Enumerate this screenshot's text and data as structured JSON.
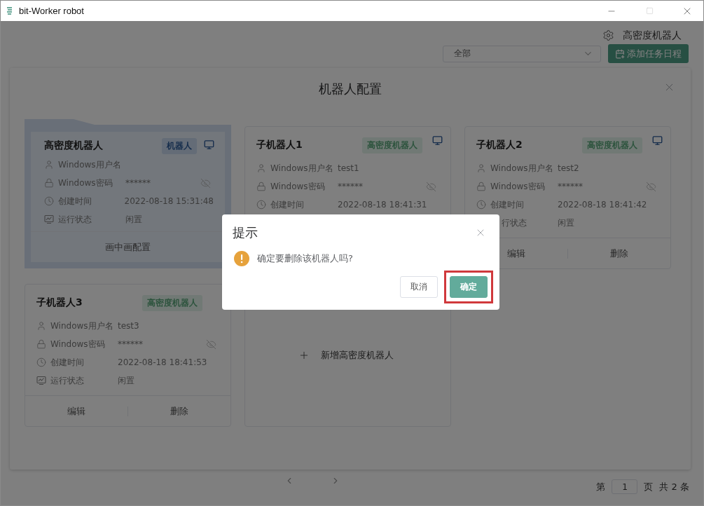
{
  "window": {
    "title": "bit-Worker robot"
  },
  "header": {
    "user": "高密度机器人",
    "filter": {
      "value": "全部"
    },
    "add_button": "添加任务日程"
  },
  "robot_config": {
    "title": "机器人配置",
    "cards": [
      {
        "kind": "robot",
        "selected": true,
        "name": "高密度机器人",
        "badge": "机器人",
        "monitor": true,
        "fields": [
          {
            "kind": "user",
            "label": "Windows用户名"
          },
          {
            "kind": "password",
            "label": "Windows密码",
            "value": "******"
          },
          {
            "kind": "time",
            "label": "创建时间",
            "value": "2022-08-18 15:31:48"
          },
          {
            "kind": "status",
            "label": "运行状态",
            "value": "闲置"
          }
        ],
        "actions": [
          "画中画配置"
        ]
      },
      {
        "kind": "robot",
        "selected": false,
        "name": "子机器人1",
        "badge": "高密度机器人",
        "monitor": true,
        "fields": [
          {
            "kind": "user",
            "label": "Windows用户名",
            "value": "test1"
          },
          {
            "kind": "password",
            "label": "Windows密码",
            "value": "******"
          },
          {
            "kind": "time",
            "label": "创建时间",
            "value": "2022-08-18 18:41:31"
          }
        ]
      },
      {
        "kind": "robot",
        "selected": false,
        "name": "子机器人2",
        "badge": "高密度机器人",
        "monitor": true,
        "fields": [
          {
            "kind": "user",
            "label": "Windows用户名",
            "value": "test2"
          },
          {
            "kind": "password",
            "label": "Windows密码",
            "value": "******"
          },
          {
            "kind": "time",
            "label": "创建时间",
            "value": "2022-08-18 18:41:42"
          },
          {
            "kind": "status",
            "label": "行状态",
            "value": "闲置",
            "clipped": true
          }
        ],
        "actions": [
          "编辑",
          "删除"
        ]
      },
      {
        "kind": "robot",
        "selected": false,
        "name": "子机器人3",
        "badge": "高密度机器人",
        "monitor": false,
        "fields": [
          {
            "kind": "user",
            "label": "Windows用户名",
            "value": "test3"
          },
          {
            "kind": "password",
            "label": "Windows密码",
            "value": "******"
          },
          {
            "kind": "time",
            "label": "创建时间",
            "value": "2022-08-18 18:41:53"
          },
          {
            "kind": "status",
            "label": "运行状态",
            "value": "闲置"
          }
        ],
        "actions": [
          "编辑",
          "删除"
        ]
      },
      {
        "kind": "add",
        "label": "新增高密度机器人"
      }
    ]
  },
  "dialog": {
    "title": "提示",
    "message": "确定要删除该机器人吗?",
    "buttons": [
      {
        "label": "取消",
        "kind": "secondary",
        "highlighted": false
      },
      {
        "label": "确定",
        "kind": "primary",
        "highlighted": true
      }
    ]
  },
  "pagination": {
    "prefix": "第",
    "page": "1",
    "suffix": "页",
    "total": "共 2 条"
  }
}
